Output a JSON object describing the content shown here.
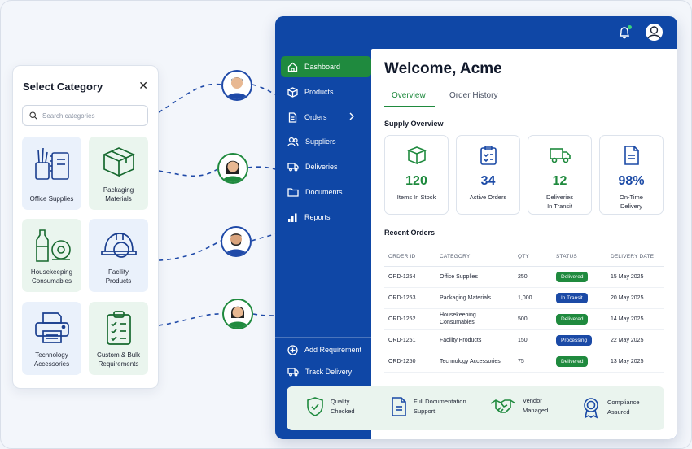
{
  "category_panel": {
    "title": "Select Category",
    "search_placeholder": "Search categories",
    "tiles": [
      {
        "label": "Office Supplies",
        "icon": "office-supplies-icon"
      },
      {
        "label": "Packaging Materials",
        "icon": "box-icon"
      },
      {
        "label": "Housekeeping Consumables",
        "icon": "cleaning-supplies-icon"
      },
      {
        "label": "Facility Products",
        "icon": "hard-hat-icon"
      },
      {
        "label": "Technology Accessories",
        "icon": "printer-icon"
      },
      {
        "label": "Custom & Bulk Requirements",
        "icon": "checklist-icon"
      }
    ]
  },
  "nav": {
    "items": [
      {
        "label": "Dashboard",
        "icon": "home-icon",
        "active": true
      },
      {
        "label": "Products",
        "icon": "cube-icon"
      },
      {
        "label": "Orders",
        "icon": "document-icon"
      },
      {
        "label": "Suppliers",
        "icon": "users-icon"
      },
      {
        "label": "Deliveries",
        "icon": "truck-icon"
      },
      {
        "label": "Documents",
        "icon": "folder-icon"
      },
      {
        "label": "Reports",
        "icon": "bar-chart-icon"
      }
    ],
    "bottom": [
      {
        "label": "Add Requirement",
        "icon": "plus-circle-icon"
      },
      {
        "label": "Track Delivery",
        "icon": "truck-icon"
      }
    ]
  },
  "main": {
    "welcome": "Welcome, Acme",
    "tabs": [
      "Overview",
      "Order History"
    ],
    "supply_title": "Supply Overview",
    "stats": [
      {
        "value": "120",
        "label": "Items In Stock",
        "color": "#1f8a3e"
      },
      {
        "value": "34",
        "label": "Active Orders",
        "color": "#1b4aa6"
      },
      {
        "value": "12",
        "label": "Deliveries In Transit",
        "color": "#1f8a3e"
      },
      {
        "value": "98%",
        "label": "On-Time Delivery",
        "color": "#1b4aa6"
      }
    ],
    "recent_title": "Recent Orders",
    "columns": [
      "ORDER ID",
      "CATEGORY",
      "QTY",
      "STATUS",
      "DELIVERY DATE"
    ],
    "rows": [
      {
        "id": "ORD-1254",
        "category": "Office Supplies",
        "qty": "250",
        "status": "Delivered",
        "date": "15 May 2025"
      },
      {
        "id": "ORD-1253",
        "category": "Packaging Materials",
        "qty": "1,000",
        "status": "In Transit",
        "date": "20 May 2025"
      },
      {
        "id": "ORD-1252",
        "category": "Housekeeping Consumables",
        "qty": "500",
        "status": "Delivered",
        "date": "14 May 2025"
      },
      {
        "id": "ORD-1251",
        "category": "Facility Products",
        "qty": "150",
        "status": "Processing",
        "date": "22 May 2025"
      },
      {
        "id": "ORD-1250",
        "category": "Technology Accessories",
        "qty": "75",
        "status": "Delivered",
        "date": "13 May 2025"
      }
    ]
  },
  "features": [
    {
      "label": "Quality Checked",
      "icon": "shield-check-icon"
    },
    {
      "label": "Full Documentation Support",
      "icon": "document-icon"
    },
    {
      "label": "Vendor Managed",
      "icon": "handshake-icon"
    },
    {
      "label": "Compliance Assured",
      "icon": "badge-icon"
    }
  ],
  "colors": {
    "brand_blue": "#0f47a6",
    "accent_green": "#1f8a3e"
  }
}
